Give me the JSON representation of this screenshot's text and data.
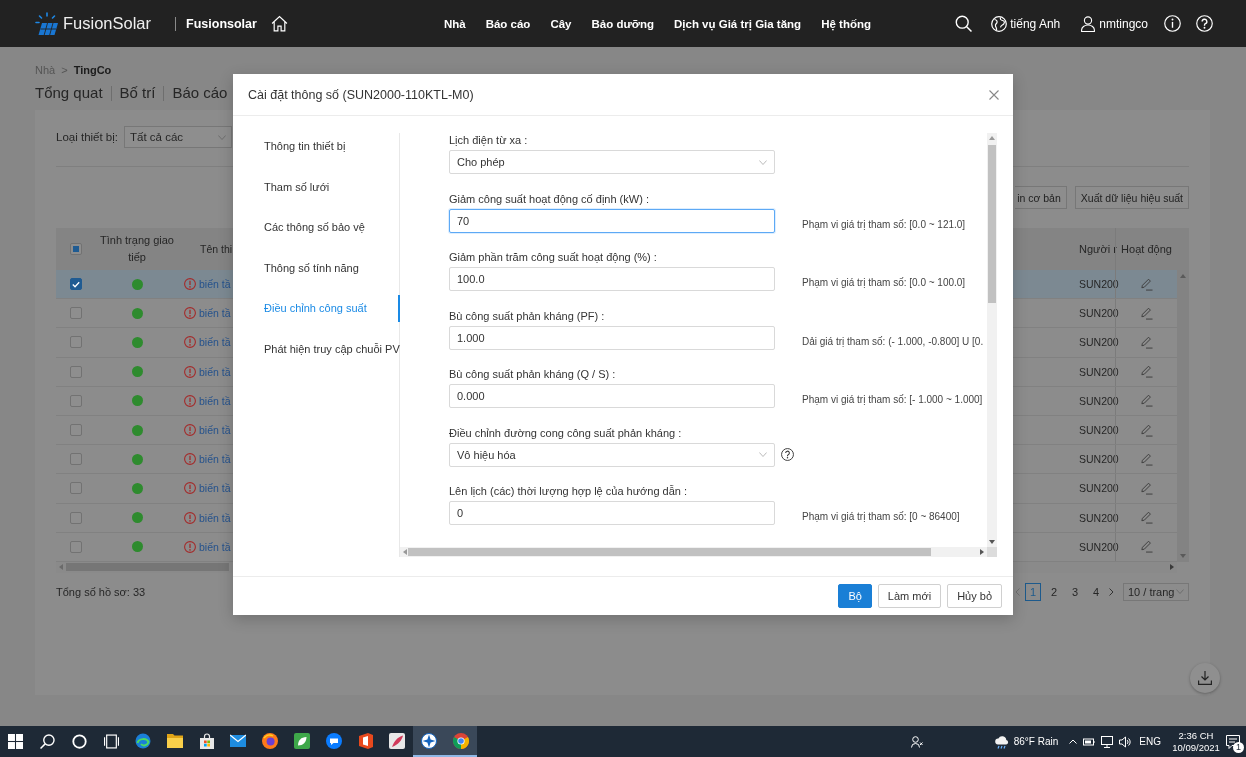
{
  "header": {
    "brand": "FusionSolar",
    "site": "Fusionsolar",
    "nav": [
      {
        "label": "Nhà"
      },
      {
        "label": "Báo cáo"
      },
      {
        "label": "Cây"
      },
      {
        "label": "Bảo dưỡng"
      },
      {
        "label": "Dịch vụ Giá trị Gia tăng"
      },
      {
        "label": "Hệ thống"
      }
    ],
    "language": "tiếng Anh",
    "user": "nmtingco"
  },
  "breadcrumb": [
    {
      "label": "Nhà",
      "current": false
    },
    {
      "label": "TingCo",
      "current": true
    }
  ],
  "breadcrumb_separator": ">",
  "page_tabs": [
    {
      "label": "Tổng quat",
      "selected": false
    },
    {
      "label": "Bố trí",
      "selected": false
    },
    {
      "label": "Báo cáo",
      "selected": false
    }
  ],
  "filter": {
    "label": "Loại thiết bị:",
    "value": "Tất cả các"
  },
  "actions": [
    "in cơ bản",
    "Xuất dữ liệu hiệu suất"
  ],
  "table": {
    "select_all": {
      "checked": false,
      "partial": true
    },
    "columns": [
      "Tình trạng giao tiếp",
      "Tên thi",
      "Người r",
      "Hoạt động"
    ],
    "rows": [
      {
        "selected": true,
        "color": "#2e8b2e",
        "name": "biến tầ",
        "model": "SUN200"
      },
      {
        "selected": false,
        "color": "#2e8b2e",
        "name": "biến tầ",
        "model": "SUN200"
      },
      {
        "selected": false,
        "color": "#2e8b2e",
        "name": "biến tầ",
        "model": "SUN200"
      },
      {
        "selected": false,
        "color": "#2e8b2e",
        "name": "biến tầ",
        "model": "SUN200"
      },
      {
        "selected": false,
        "color": "#2e8b2e",
        "name": "biến tầ",
        "model": "SUN200"
      },
      {
        "selected": false,
        "color": "#2e8b2e",
        "name": "biến tầ",
        "model": "SUN200"
      },
      {
        "selected": false,
        "color": "#2e8b2e",
        "name": "biến tầ",
        "model": "SUN200"
      },
      {
        "selected": false,
        "color": "#2e8b2e",
        "name": "biến tầ",
        "model": "SUN200"
      },
      {
        "selected": false,
        "color": "#2e8b2e",
        "name": "biến tầ",
        "model": "SUN200"
      },
      {
        "selected": false,
        "color": "#2e8b2e",
        "name": "biến tầ",
        "model": "SUN200"
      }
    ]
  },
  "record_count": "Tổng số hồ sơ: 33",
  "pagination": {
    "prev_disabled": true,
    "pages": [
      {
        "label": "1",
        "selected": true
      },
      {
        "label": "2",
        "selected": false
      },
      {
        "label": "3",
        "selected": false
      },
      {
        "label": "4",
        "selected": false
      }
    ],
    "page_size": "10 / trang"
  },
  "dialog": {
    "title": "Cài đặt thông số (SUN2000-110KTL-M0)",
    "menu": [
      {
        "label": "Thông tin thiết bị",
        "selected": false
      },
      {
        "label": "Tham số lưới",
        "selected": false
      },
      {
        "label": "Các thông số bảo vệ",
        "selected": false
      },
      {
        "label": "Thông số tính năng",
        "selected": false
      },
      {
        "label": "Điều chỉnh công suất",
        "selected": true
      },
      {
        "label": "Phát hiện truy cập chuỗi PV",
        "selected": false
      }
    ],
    "fields": [
      {
        "kind": "select",
        "label": "Lịch điện từ xa :",
        "value": "Cho phép",
        "focused": false,
        "help": false
      },
      {
        "kind": "input",
        "label": "Giảm công suất hoạt động cố định (kW) :",
        "value": "70",
        "focused": true,
        "help": false,
        "hint": "Phạm vi giá trị tham số: [0.0 ~ 121.0]"
      },
      {
        "kind": "input",
        "label": "Giảm phần trăm công suất hoạt động (%) :",
        "value": "100.0",
        "focused": false,
        "help": false,
        "hint": "Phạm vi giá trị tham số: [0.0 ~ 100.0]"
      },
      {
        "kind": "input",
        "label": "Bù công suất phản kháng (PF) :",
        "value": "1.000",
        "focused": false,
        "help": false,
        "hint": "Dải giá trị tham số: (- 1.000, -0.800] U [0."
      },
      {
        "kind": "input",
        "label": "Bù công suất phản kháng (Q / S) :",
        "value": "0.000",
        "focused": false,
        "help": false,
        "hint": "Phạm vi giá trị tham số: [- 1.000 ~ 1.000]"
      },
      {
        "kind": "select",
        "label": "Điều chỉnh đường cong công suất phản kháng :",
        "value": "Vô hiệu hóa",
        "focused": false,
        "help": true
      },
      {
        "kind": "input",
        "label": "Lên lịch (các) thời lượng hợp lệ của hướng dẫn :",
        "value": "0",
        "focused": false,
        "help": false,
        "hint": "Phạm vi giá trị tham số: [0 ~ 86400]"
      }
    ],
    "buttons": [
      {
        "label": "Bộ",
        "kind": "primary"
      },
      {
        "label": "Làm mới",
        "kind": "reset"
      },
      {
        "label": "Hủy bỏ",
        "kind": "cancel"
      }
    ]
  },
  "taskbar": {
    "apps": [
      {
        "kind": "swirl",
        "open": false
      },
      {
        "kind": "folder",
        "open": false
      },
      {
        "kind": "bag",
        "open": false
      },
      {
        "kind": "envelope",
        "open": false
      },
      {
        "kind": "fox",
        "open": false
      },
      {
        "kind": "leaf",
        "open": false
      },
      {
        "kind": "chat",
        "open": false
      },
      {
        "kind": "square",
        "open": false
      },
      {
        "kind": "feather",
        "open": false
      },
      {
        "kind": "compass",
        "open": true
      },
      {
        "kind": "wheel",
        "open": true
      }
    ],
    "weather": "86°F Rain",
    "language": "ENG",
    "time": "2:36 CH",
    "date": "10/09/2021",
    "notifications": "1"
  }
}
